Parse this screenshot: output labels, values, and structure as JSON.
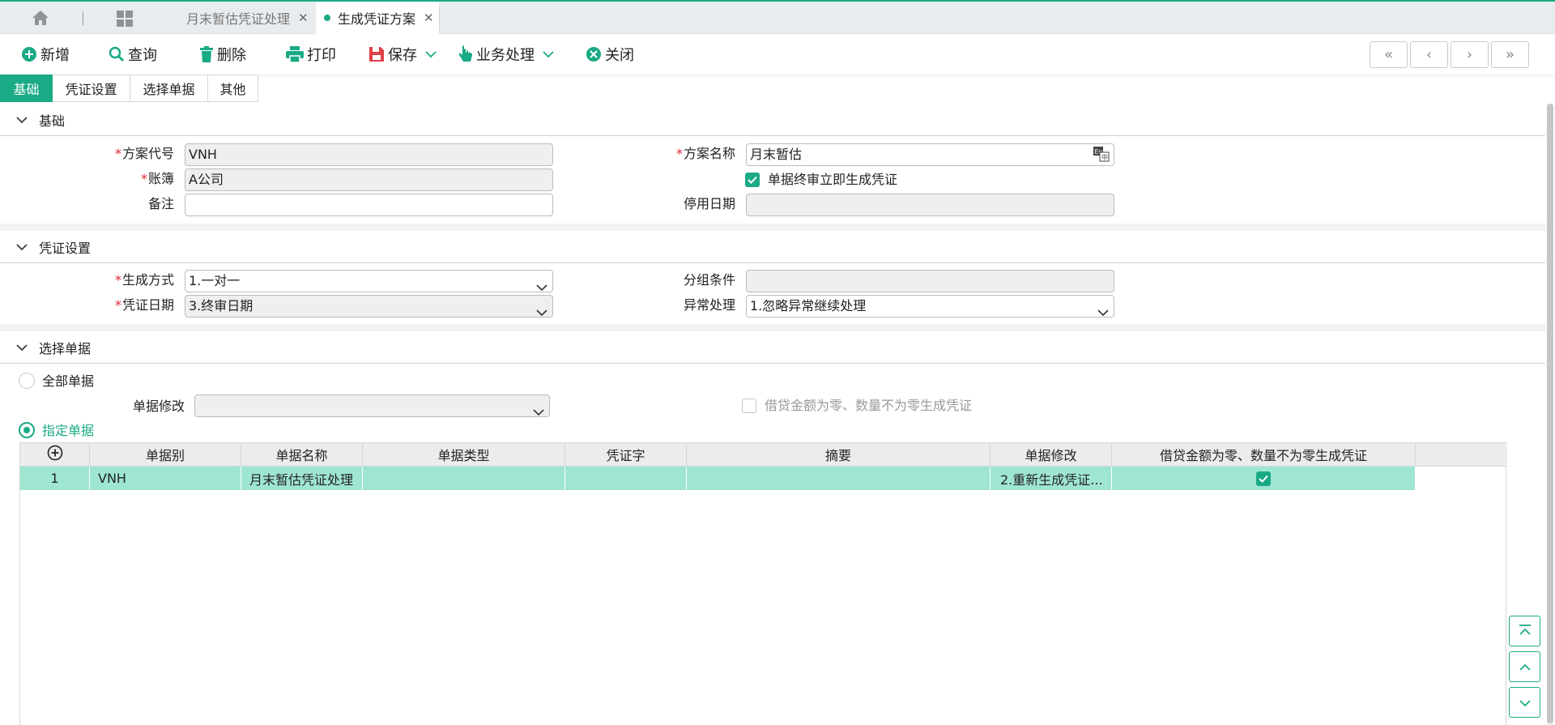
{
  "tabs": [
    {
      "label": "月末暂估凭证处理",
      "close": "✕"
    },
    {
      "label": "生成凭证方案",
      "close": "✕"
    }
  ],
  "toolbar": {
    "add": "新增",
    "query": "查询",
    "delete": "删除",
    "print": "打印",
    "save": "保存",
    "business": "业务处理",
    "close": "关闭",
    "nav": [
      "«",
      "‹",
      "›",
      "»"
    ]
  },
  "subtabs": [
    "基础",
    "凭证设置",
    "选择单据",
    "其他"
  ],
  "basic": {
    "title": "基础",
    "code_label": "方案代号",
    "code_value": "VNH",
    "name_label": "方案名称",
    "name_value": "月末暂估",
    "book_label": "账簿",
    "book_value": "A公司",
    "auto_gen_label": "单据终审立即生成凭证",
    "auto_gen_checked": true,
    "remark_label": "备注",
    "remark_value": "",
    "disable_date_label": "停用日期",
    "disable_date_value": ""
  },
  "voucher": {
    "title": "凭证设置",
    "gen_mode_label": "生成方式",
    "gen_mode_value": "1.一对一",
    "group_label": "分组条件",
    "group_value": "",
    "date_label": "凭证日期",
    "date_value": "3.终审日期",
    "exception_label": "异常处理",
    "exception_value": "1.忽略异常继续处理"
  },
  "select": {
    "title": "选择单据",
    "all_label": "全部单据",
    "modify_label": "单据修改",
    "modify_value": "",
    "zero_label": "借贷金额为零、数量不为零生成凭证",
    "zero_checked": false,
    "specified_label": "指定单据",
    "specified_selected": true
  },
  "grid": {
    "columns": [
      "单据别",
      "单据名称",
      "单据类型",
      "凭证字",
      "摘要",
      "单据修改",
      "借贷金额为零、数量不为零生成凭证"
    ],
    "rows": [
      {
        "no": "1",
        "code": "VNH",
        "name": "月末暂估凭证处理",
        "type": "",
        "word": "",
        "summary": "",
        "modify": "2.重新生成凭证...",
        "zero": true
      }
    ]
  },
  "colors": {
    "accent": "#1aaa85",
    "row_selected": "#9fe6d2",
    "required": "#e0242e"
  }
}
